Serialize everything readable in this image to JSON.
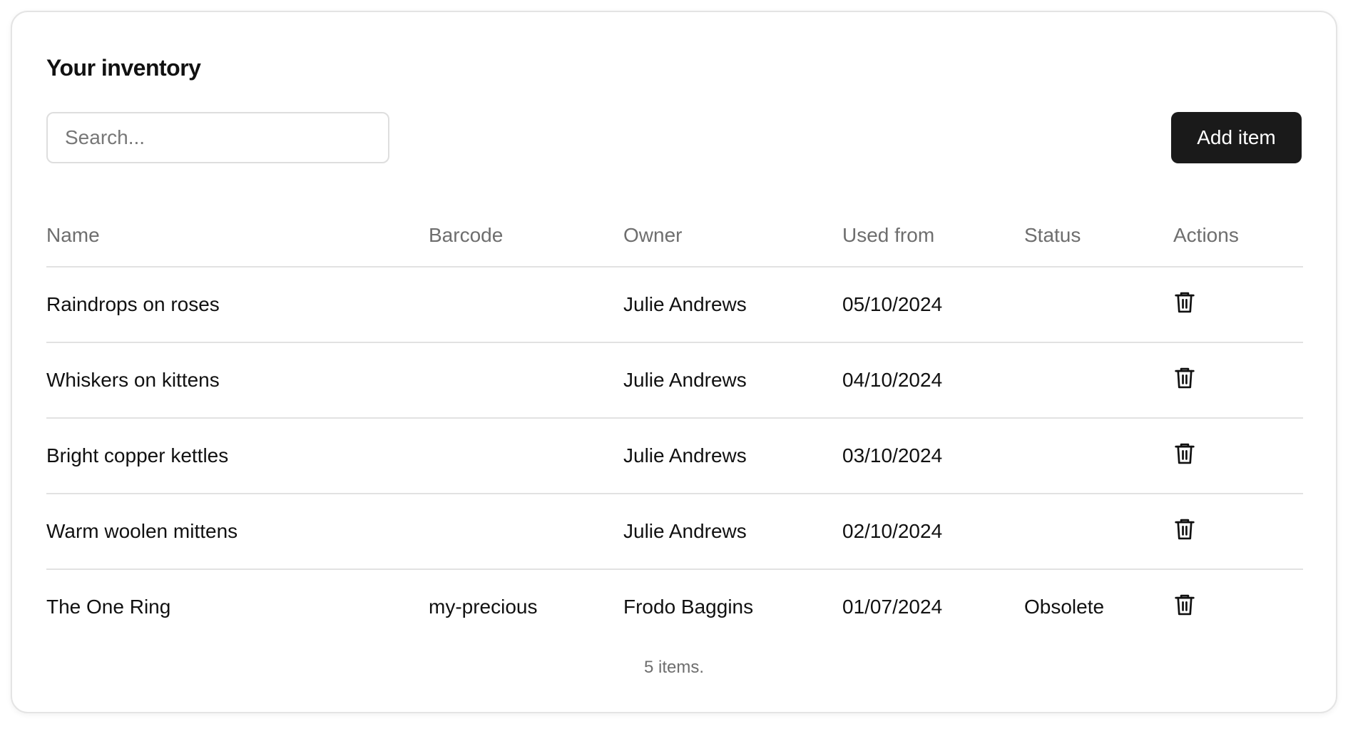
{
  "header": {
    "title": "Your inventory"
  },
  "toolbar": {
    "search_placeholder": "Search...",
    "search_value": "",
    "add_label": "Add item"
  },
  "table": {
    "columns": [
      "Name",
      "Barcode",
      "Owner",
      "Used from",
      "Status",
      "Actions"
    ],
    "rows": [
      {
        "name": "Raindrops on roses",
        "barcode": "",
        "owner": "Julie Andrews",
        "used_from": "05/10/2024",
        "status": "",
        "action_icon": "trash-icon"
      },
      {
        "name": "Whiskers on kittens",
        "barcode": "",
        "owner": "Julie Andrews",
        "used_from": "04/10/2024",
        "status": "",
        "action_icon": "trash-icon"
      },
      {
        "name": "Bright copper kettles",
        "barcode": "",
        "owner": "Julie Andrews",
        "used_from": "03/10/2024",
        "status": "",
        "action_icon": "trash-icon"
      },
      {
        "name": "Warm woolen mittens",
        "barcode": "",
        "owner": "Julie Andrews",
        "used_from": "02/10/2024",
        "status": "",
        "action_icon": "trash-icon"
      },
      {
        "name": "The One Ring",
        "barcode": "my-precious",
        "owner": "Frodo Baggins",
        "used_from": "01/07/2024",
        "status": "Obsolete",
        "action_icon": "trash-icon"
      }
    ]
  },
  "footer": {
    "count_text": "5 items."
  },
  "colors": {
    "primary_button": "#1a1a1a",
    "muted_text": "#6e6e6e",
    "border": "#e2e2e2"
  }
}
